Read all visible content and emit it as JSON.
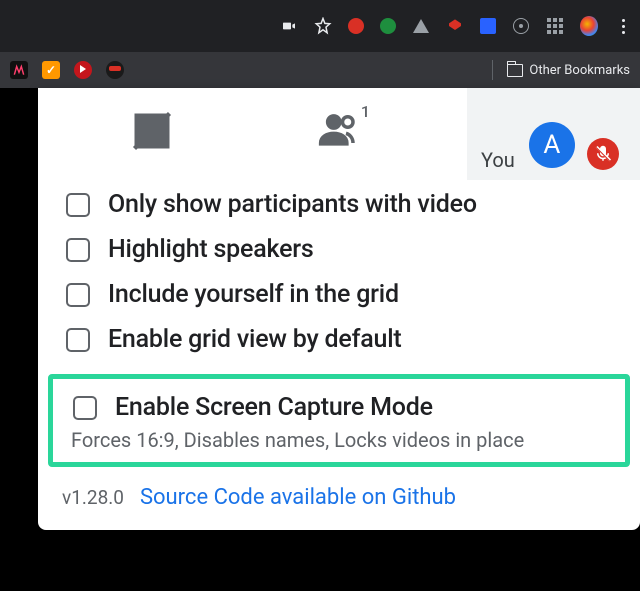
{
  "chrome": {
    "other_bookmarks_label": "Other Bookmarks"
  },
  "you_pill": {
    "label": "You",
    "avatar_letter": "A"
  },
  "tabs": {
    "people_count": "1"
  },
  "options": [
    {
      "label": "Only show participants with video"
    },
    {
      "label": "Highlight speakers"
    },
    {
      "label": "Include yourself in the grid"
    },
    {
      "label": "Enable grid view by default"
    }
  ],
  "highlighted_option": {
    "label": "Enable Screen Capture Mode",
    "description": "Forces 16:9, Disables names, Locks videos in place"
  },
  "footer": {
    "version": "v1.28.0",
    "source_link": "Source Code available on Github"
  }
}
